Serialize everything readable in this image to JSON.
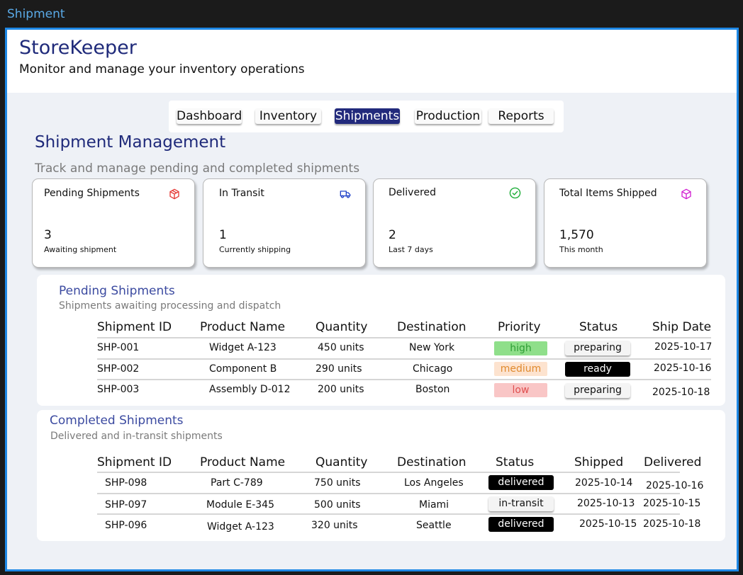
{
  "window": {
    "title": "Shipment"
  },
  "header": {
    "app_name": "StoreKeeper",
    "subtitle": "Monitor and manage your inventory operations"
  },
  "nav": {
    "tabs": [
      "Dashboard",
      "Inventory",
      "Shipments",
      "Production",
      "Reports"
    ],
    "active": "Shipments"
  },
  "page": {
    "title": "Shipment Management",
    "subtitle": "Track and manage pending and completed shipments"
  },
  "stats": [
    {
      "label": "Pending Shipments",
      "value": "3",
      "note": "Awaiting shipment",
      "icon": "package-icon",
      "icon_color": "#e53935"
    },
    {
      "label": "In Transit",
      "value": "1",
      "note": "Currently shipping",
      "icon": "truck-icon",
      "icon_color": "#1e40c8"
    },
    {
      "label": "Delivered",
      "value": "2",
      "note": "Last 7 days",
      "icon": "check-circle-icon",
      "icon_color": "#1fae3a"
    },
    {
      "label": "Total Items Shipped",
      "value": "1,570",
      "note": "This month",
      "icon": "box-icon",
      "icon_color": "#d11fd1"
    }
  ],
  "pending": {
    "title": "Pending Shipments",
    "subtitle": "Shipments awaiting processing and dispatch",
    "columns": [
      "Shipment ID",
      "Product Name",
      "Quantity",
      "Destination",
      "Priority",
      "Status",
      "Ship Date"
    ],
    "rows": [
      {
        "id": "SHP-001",
        "product": "Widget A-123",
        "quantity": "450 units",
        "destination": "New York",
        "priority": "high",
        "status": "preparing",
        "ship_date": "2025-10-17"
      },
      {
        "id": "SHP-002",
        "product": "Component B",
        "quantity": "290 units",
        "destination": "Chicago",
        "priority": "medium",
        "status": "ready",
        "ship_date": "2025-10-16"
      },
      {
        "id": "SHP-003",
        "product": "Assembly D-012",
        "quantity": "200 units",
        "destination": "Boston",
        "priority": "low",
        "status": "preparing",
        "ship_date": "2025-10-18"
      }
    ]
  },
  "completed": {
    "title": "Completed Shipments",
    "subtitle": "Delivered and in-transit shipments",
    "columns": [
      "Shipment ID",
      "Product Name",
      "Quantity",
      "Destination",
      "Status",
      "Shipped",
      "Delivered"
    ],
    "rows": [
      {
        "id": "SHP-098",
        "product": "Part C-789",
        "quantity": "750 units",
        "destination": "Los Angeles",
        "status": "delivered",
        "shipped": "2025-10-14",
        "delivered": "2025-10-16"
      },
      {
        "id": "SHP-097",
        "product": "Module E-345",
        "quantity": "500 units",
        "destination": "Miami",
        "status": "in-transit",
        "shipped": "2025-10-13",
        "delivered": "2025-10-15"
      },
      {
        "id": "SHP-096",
        "product": "Widget A-123",
        "quantity": "320 units",
        "destination": "Seattle",
        "status": "delivered",
        "shipped": "2025-10-15",
        "delivered": "2025-10-18"
      }
    ]
  },
  "colors": {
    "accent": "#222a7c",
    "priority_high_bg": "#8fdf8a",
    "priority_high_fg": "#2e9e35",
    "priority_medium_bg": "#fde3cf",
    "priority_medium_fg": "#e08a2e",
    "priority_low_bg": "#f9c6c6",
    "priority_low_fg": "#e05050"
  }
}
